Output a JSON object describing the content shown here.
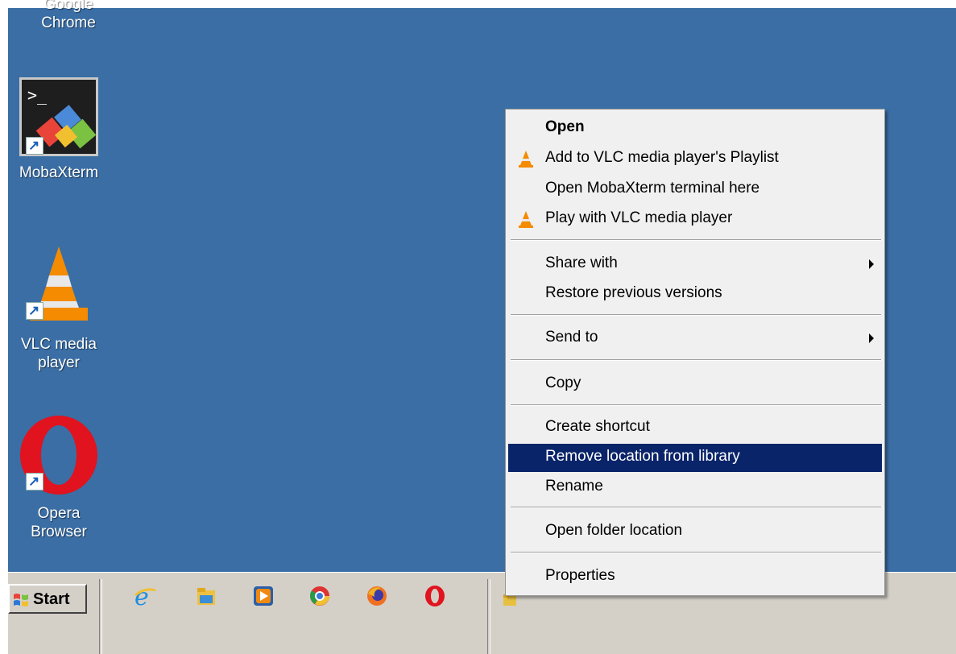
{
  "desktop": {
    "icons": [
      {
        "label_line1": "Google",
        "label_line2": "Chrome",
        "icon": "chrome-icon"
      },
      {
        "label_line1": "MobaXterm",
        "label_line2": "",
        "icon": "mobaxterm-icon"
      },
      {
        "label_line1": "VLC media",
        "label_line2": "player",
        "icon": "vlc-icon"
      },
      {
        "label_line1": "Opera",
        "label_line2": "Browser",
        "icon": "opera-icon"
      }
    ],
    "background_color": "#3a6ea5"
  },
  "context_menu": {
    "items": [
      {
        "label": "Open",
        "bold": true
      },
      {
        "label": "Add to VLC media player's Playlist",
        "icon": "vlc-cone-icon"
      },
      {
        "label": "Open MobaXterm terminal here"
      },
      {
        "label": "Play with VLC media player",
        "icon": "vlc-cone-icon"
      },
      {
        "label": "Share with",
        "submenu": true
      },
      {
        "label": "Restore previous versions"
      },
      {
        "label": "Send to",
        "submenu": true
      },
      {
        "label": "Copy"
      },
      {
        "label": "Create shortcut"
      },
      {
        "label": "Remove location from library",
        "selected": true
      },
      {
        "label": "Rename"
      },
      {
        "label": "Open folder location"
      },
      {
        "label": "Properties"
      }
    ],
    "selected_color": "#0a246a"
  },
  "taskbar": {
    "start_label": "Start",
    "quick_launch": [
      "internet-explorer-icon",
      "file-explorer-icon",
      "media-player-icon",
      "chrome-icon",
      "firefox-icon",
      "opera-icon"
    ]
  }
}
